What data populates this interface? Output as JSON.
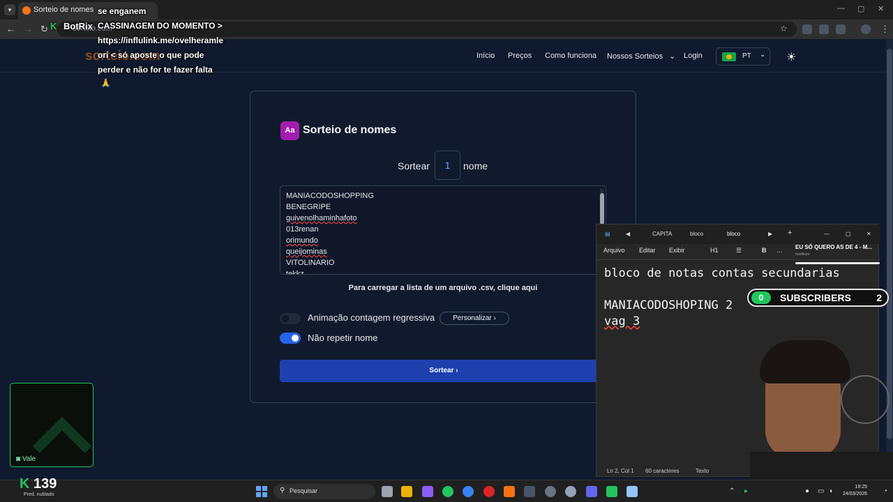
{
  "browser": {
    "tab_title": "Sorteio de nomes",
    "url": "sorteio.com"
  },
  "site": {
    "logo": "sorteio.com",
    "nav": {
      "inicio": "Início",
      "precos": "Preços",
      "como_funciona": "Como funciona",
      "nossos_sorteios": "Nossos Sorteios",
      "login": "Login"
    },
    "lang": "PT"
  },
  "card": {
    "icon": "Aa",
    "title": "Sorteio de nomes",
    "sortear_label": "Sortear",
    "quantity": "1",
    "nome_label": "nome",
    "names": [
      "MANIACODOSHOPPING",
      "BENEGRIPE",
      "guivenolhaminhafoto",
      "013renan",
      "orimundo",
      "queijominas",
      "VITOLINARIO",
      "tekkz"
    ],
    "csv_text": "Para carregar a lista de um arquivo .csv, clique aqui",
    "toggle_countdown": "Animação contagem regressiva",
    "personalizar": "Personalizar",
    "toggle_no_repeat": "Não repetir nome",
    "submit": "Sortear"
  },
  "notepad": {
    "tabs": [
      "CAPITA",
      "bloco",
      "bloco"
    ],
    "menu": {
      "arquivo": "Arquivo",
      "editar": "Editar",
      "exibir": "Exibir",
      "h1": "H1"
    },
    "lines": [
      "bloco de notas contas secundarias",
      "",
      "MANIACODOSHOPING 2",
      "vag 3"
    ],
    "status": {
      "pos": "Ln 2, Col 1",
      "chars": "60 caracteres",
      "type": "Texto"
    }
  },
  "overlay": {
    "chat_lines": [
      "se enganem",
      "CASSINAGEM DO MOMENTO >",
      "https://influlink.me/ovelheramle",
      "ori < só aposte o que pode",
      "perder e não for te fazer falta"
    ],
    "botrix": "BotRix",
    "subscribers_label": "SUBSCRIBERS",
    "subscribers_left": "0",
    "subscribers_right": "2",
    "media_title": "EU SÓ QUERO AS DE 4 - M...",
    "media_sub": "markkum",
    "webcam_label": "Vale",
    "kick_count": "139"
  },
  "taskbar": {
    "weather": "Pred. nublado",
    "search_placeholder": "Pesquisar",
    "time": "19:25",
    "date": "24/03/2026"
  },
  "colors": {
    "page_bg": "#0f1a2e",
    "accent_button": "#1e40af",
    "logo_orange": "#f97316",
    "toggle_on": "#2563eb",
    "kick_green": "#22c55e"
  }
}
